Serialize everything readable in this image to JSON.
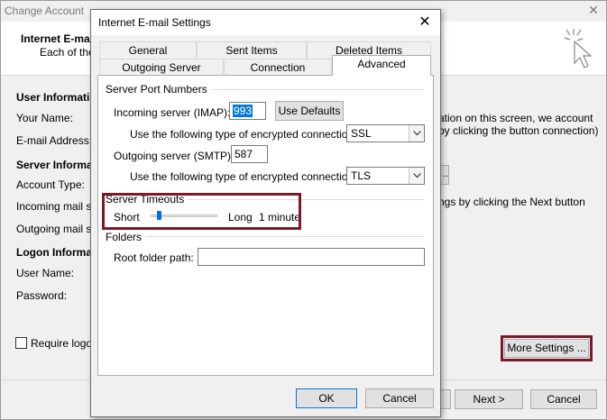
{
  "background_window": {
    "title": "Change Account",
    "close_glyph": "✕",
    "header_title": "Internet E-ma",
    "header_subtitle": "Each of the",
    "sections": {
      "user_info": "User Informati",
      "server_info": "Server Informa",
      "logon_info": "Logon Informa"
    },
    "labels": {
      "your_name": "Your Name:",
      "email": "E-mail Address:",
      "account_type": "Account Type:",
      "incoming": "Incoming mail ser",
      "outgoing": "Outgoing mail ser",
      "user_name": "User Name:",
      "password": "Password:"
    },
    "right_text_1": "ation on this screen, we account by clicking the button connection)",
    "right_text_2": "ngs by clicking the Next button",
    "small_button_label": "..",
    "require_logon_label": "Require logon",
    "more_settings_label": "More Settings ...",
    "next_label": "Next >",
    "cancel_label": "Cancel"
  },
  "dialog": {
    "title": "Internet E-mail Settings",
    "close_glyph": "✕",
    "tabs_row1": [
      "General",
      "Sent Items",
      "Deleted Items"
    ],
    "tabs_row2": [
      "Outgoing Server",
      "Connection",
      "Advanced"
    ],
    "active_tab": "Advanced",
    "server_ports": {
      "title": "Server Port Numbers",
      "incoming_label": "Incoming server (IMAP):",
      "incoming_value": "993",
      "use_defaults_label": "Use Defaults",
      "encryption_label": "Use the following type of encrypted connection:",
      "incoming_encryption": "SSL",
      "outgoing_label": "Outgoing server (SMTP):",
      "outgoing_value": "587",
      "outgoing_encryption": "TLS"
    },
    "timeouts": {
      "title": "Server Timeouts",
      "short_label": "Short",
      "long_label": "Long",
      "value_label": "1 minute",
      "slider_level": 0.1
    },
    "folders": {
      "title": "Folders",
      "root_label": "Root folder path:",
      "root_value": ""
    },
    "ok_label": "OK",
    "cancel_label": "Cancel"
  },
  "colors": {
    "highlight_border": "#7b1a2a",
    "slider_thumb": "#0a6ddd",
    "selection": "#0078d7"
  }
}
